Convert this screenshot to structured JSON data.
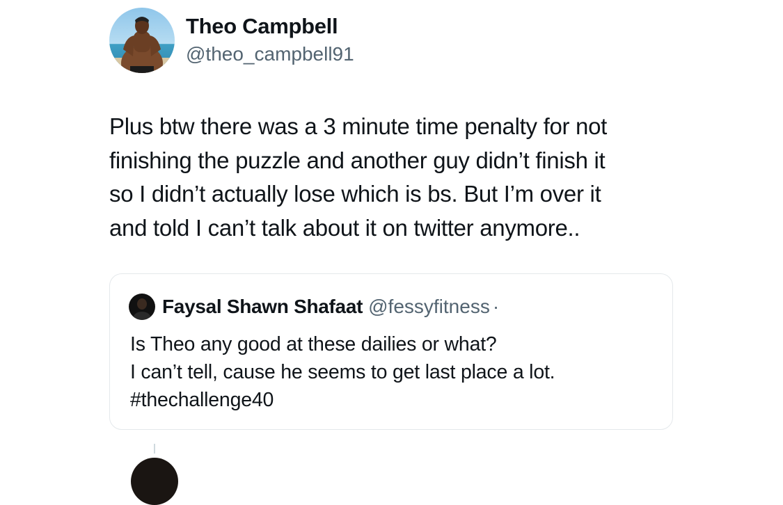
{
  "tweet": {
    "author": {
      "name": "Theo Campbell",
      "handle": "@theo_campbell91",
      "avatar_icon": "profile-photo-beach"
    },
    "text_lines": [
      "Plus btw there was a 3 minute time penalty for not",
      "finishing the puzzle and another guy didn’t finish it",
      "so I didn’t actually lose which is bs. But I’m over it",
      "and told I can’t talk about it on twitter anymore.."
    ],
    "quoted": {
      "name": "Faysal Shawn Shafaat",
      "handle": "@fessyfitness",
      "separator": "·",
      "avatar_icon": "profile-photo-dark",
      "text_lines": [
        "Is Theo any good at these dailies or what?",
        "I can’t tell, cause he seems to get last place a lot.",
        "#thechallenge40"
      ]
    }
  },
  "colors": {
    "text_primary": "#0f1419",
    "text_secondary": "#536471",
    "card_border": "#e4e8eb",
    "thread_line": "#cfd9de"
  }
}
